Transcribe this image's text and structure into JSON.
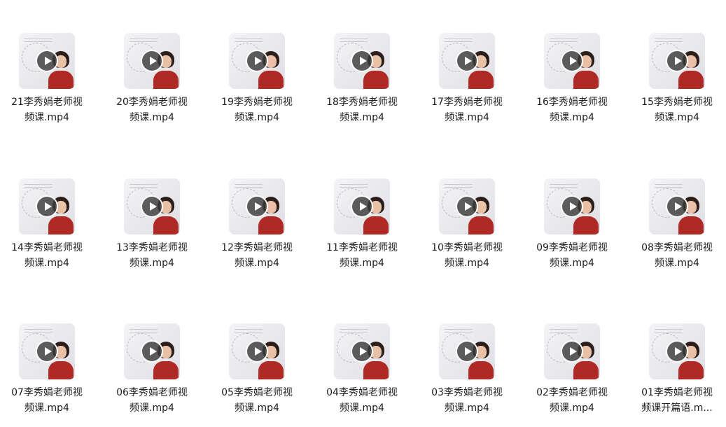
{
  "files": [
    {
      "line1": "21李秀娟老师视",
      "line2": "频课.mp4"
    },
    {
      "line1": "20李秀娟老师视",
      "line2": "频课.mp4"
    },
    {
      "line1": "19李秀娟老师视",
      "line2": "频课.mp4"
    },
    {
      "line1": "18李秀娟老师视",
      "line2": "频课.mp4"
    },
    {
      "line1": "17李秀娟老师视",
      "line2": "频课.mp4"
    },
    {
      "line1": "16李秀娟老师视",
      "line2": "频课.mp4"
    },
    {
      "line1": "15李秀娟老师视",
      "line2": "频课.mp4"
    },
    {
      "line1": "14李秀娟老师视",
      "line2": "频课.mp4"
    },
    {
      "line1": "13李秀娟老师视",
      "line2": "频课.mp4"
    },
    {
      "line1": "12李秀娟老师视",
      "line2": "频课.mp4"
    },
    {
      "line1": "11李秀娟老师视",
      "line2": "频课.mp4"
    },
    {
      "line1": "10李秀娟老师视",
      "line2": "频课.mp4"
    },
    {
      "line1": "09李秀娟老师视",
      "line2": "频课.mp4"
    },
    {
      "line1": "08李秀娟老师视",
      "line2": "频课.mp4"
    },
    {
      "line1": "07李秀娟老师视",
      "line2": "频课.mp4"
    },
    {
      "line1": "06李秀娟老师视",
      "line2": "频课.mp4"
    },
    {
      "line1": "05李秀娟老师视",
      "line2": "频课.mp4"
    },
    {
      "line1": "04李秀娟老师视",
      "line2": "频课.mp4"
    },
    {
      "line1": "03李秀娟老师视",
      "line2": "频课.mp4"
    },
    {
      "line1": "02李秀娟老师视",
      "line2": "频课.mp4"
    },
    {
      "line1": "01李秀娟老师视",
      "line2": "频课开篇语.m..."
    }
  ],
  "icons": {
    "thumbnail": "video-thumbnail-icon",
    "play": "play-icon"
  },
  "colors": {
    "background": "#ffffff",
    "play_button": "#3c3c3c",
    "shirt": "#b02a25"
  }
}
